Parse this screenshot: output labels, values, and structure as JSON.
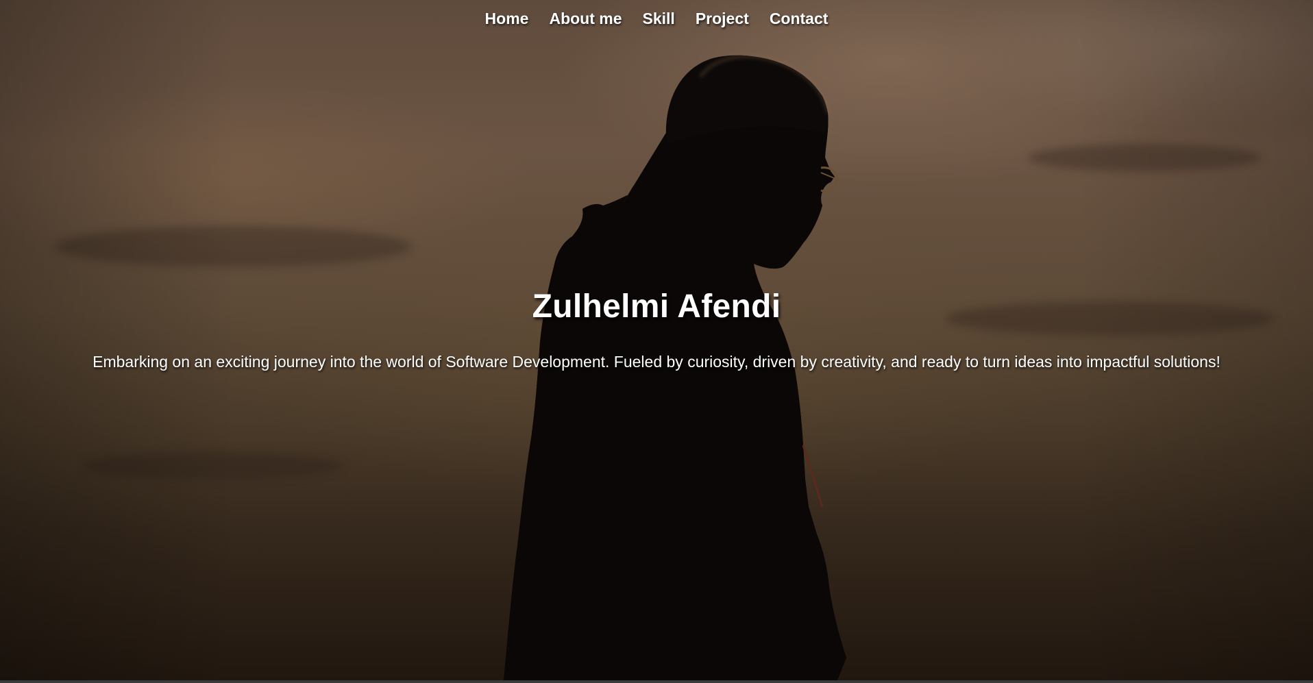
{
  "nav": {
    "items": [
      {
        "label": "Home"
      },
      {
        "label": "About me"
      },
      {
        "label": "Skill"
      },
      {
        "label": "Project"
      },
      {
        "label": "Contact"
      }
    ]
  },
  "hero": {
    "title": "Zulhelmi Afendi",
    "tagline": "Embarking on an exciting journey into the world of Software Development. Fueled by curiosity, driven by creativity, and ready to turn ideas into impactful solutions!"
  },
  "colors": {
    "text": "#ffffff",
    "sky_top": "#6b5443",
    "sky_bottom": "#21170f",
    "silhouette": "#0a0706"
  }
}
